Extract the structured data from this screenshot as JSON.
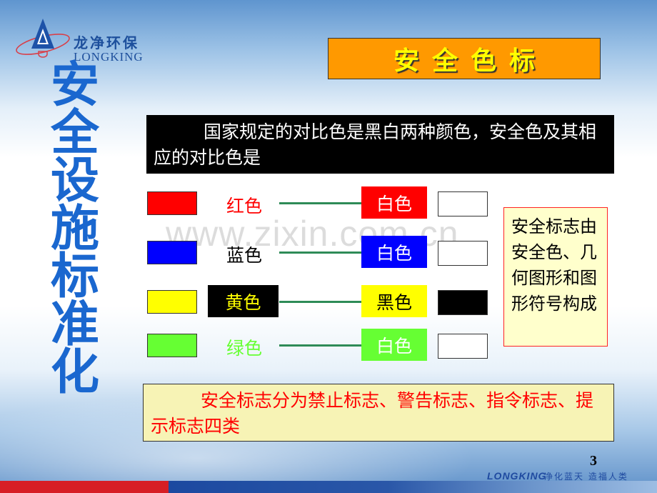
{
  "logo": {
    "name_cn": "龙净环保",
    "name_en": "LONGKING"
  },
  "vertical_title": [
    "安",
    "全",
    "设",
    "施",
    "标",
    "准",
    "化"
  ],
  "banner": {
    "title": "安全色标",
    "bg_color": "#ff9900",
    "text_color": "#ffff00"
  },
  "statement": "国家规定的对比色是黑白两种颜色，安全色及其相应的对比色是",
  "color_rows": [
    {
      "swatch": "#ff0000",
      "label": "红色",
      "label_color": "#ff0000",
      "label_bg": "",
      "contrast_label": "白色",
      "contrast_bg": "#ff0000",
      "contrast_text_color": "#ffffff",
      "contrast_swatch": "#ffffff"
    },
    {
      "swatch": "#0000ff",
      "label": "蓝色",
      "label_color": "#000000",
      "label_bg": "",
      "contrast_label": "白色",
      "contrast_bg": "#0000ff",
      "contrast_text_color": "#ffffff",
      "contrast_swatch": "#ffffff"
    },
    {
      "swatch": "#ffff00",
      "label": "黄色",
      "label_color": "#ffff00",
      "label_bg": "#000000",
      "contrast_label": "黑色",
      "contrast_bg": "#ffff00",
      "contrast_text_color": "#000000",
      "contrast_swatch": "#000000"
    },
    {
      "swatch": "#66ff33",
      "label": "绿色",
      "label_color": "#66ff33",
      "label_bg": "",
      "contrast_label": "白色",
      "contrast_bg": "#66ff33",
      "contrast_text_color": "#ffffff",
      "contrast_swatch": "#ffffff"
    }
  ],
  "side_note": "安全标志由安全色、几何图形和图形符号构成",
  "bottom_statement": "安全标志分为禁止标志、警告标志、指令标志、提示标志四类",
  "watermark": "www.zixin.com.cn",
  "footer": {
    "page_number": "3",
    "brand": "LONGKING",
    "slogan": "净化蓝天 造福人类"
  }
}
